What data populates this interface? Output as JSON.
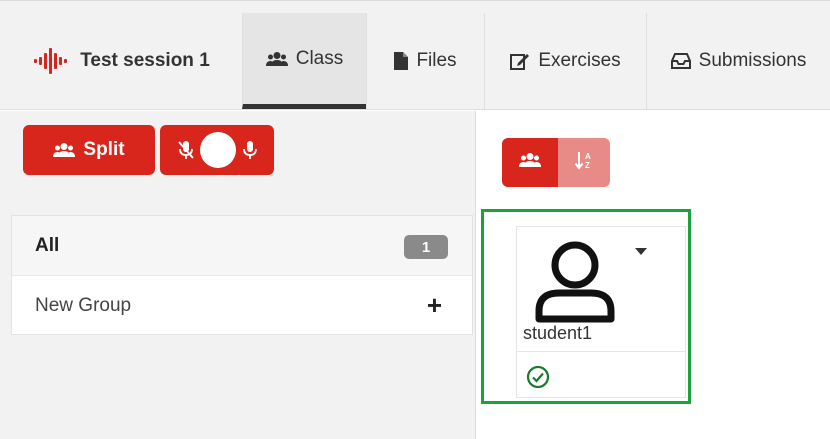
{
  "session": {
    "title": "Test session 1",
    "icon": "audio-wave-icon",
    "icon_color": "#d9261c"
  },
  "tabs": [
    {
      "label": "Class",
      "icon": "users-icon",
      "active": true
    },
    {
      "label": "Files",
      "icon": "file-icon",
      "active": false
    },
    {
      "label": "Exercises",
      "icon": "edit-icon",
      "active": false
    },
    {
      "label": "Submissions",
      "icon": "inbox-icon",
      "active": false
    }
  ],
  "toolbar": {
    "split_label": "Split"
  },
  "groups": {
    "all": {
      "label": "All",
      "count": "1"
    },
    "new_group": {
      "label": "New Group",
      "add_icon": "plus-icon"
    }
  },
  "students": [
    {
      "name": "student1",
      "status": "connected"
    }
  ],
  "colors": {
    "accent": "#d9261c",
    "accent_light": "#e88a86",
    "highlight": "#1aa33a",
    "success": "#1a7a2e"
  }
}
